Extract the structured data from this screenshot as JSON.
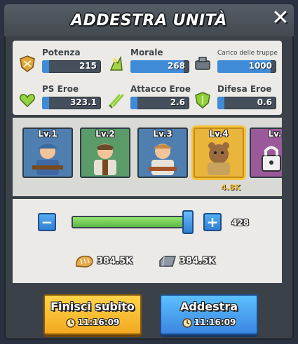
{
  "window": {
    "title": "ADDESTRA UNITÀ"
  },
  "stats": [
    {
      "label": "Potenza",
      "value": "215",
      "icon": "power-shield-icon",
      "fill": 0.12
    },
    {
      "label": "Morale",
      "value": "268",
      "icon": "morale-icon",
      "fill": 0.9
    },
    {
      "label": "Carico delle truppe",
      "value": "1000",
      "icon": "troop-load-icon",
      "fill": 0.9
    },
    {
      "label": "PS Eroe",
      "value": "323.1",
      "icon": "hero-hp-icon",
      "fill": 0.12
    },
    {
      "label": "Attacco Eroe",
      "value": "2.6",
      "icon": "hero-attack-icon",
      "fill": 0.12
    },
    {
      "label": "Difesa Eroe",
      "value": "0.6",
      "icon": "hero-defense-icon",
      "fill": 0.12
    }
  ],
  "units": [
    {
      "level": "Lv.1",
      "bg": "#4f7fb0"
    },
    {
      "level": "Lv.2",
      "bg": "#5b9b6a"
    },
    {
      "level": "Lv.3",
      "bg": "#4f7fb0"
    },
    {
      "level": "Lv.4",
      "bg": "#e9b53a",
      "selected": true
    },
    {
      "level": "Lv.",
      "bg": "#9a5a9a",
      "locked": true
    }
  ],
  "unit_cost": "4.8K",
  "quantity": {
    "minus": "−",
    "plus": "+",
    "value": "428",
    "fraction": 1.0
  },
  "resources": [
    {
      "amount": "384.5K",
      "icon": "bread-icon"
    },
    {
      "amount": "384.5K",
      "icon": "iron-ingot-icon"
    }
  ],
  "buttons": {
    "finish_now": {
      "label": "Finisci subito",
      "time": "11:16:09"
    },
    "train": {
      "label": "Addestra",
      "time": "11:16:09"
    }
  },
  "colors": {
    "accent_blue": "#3f8bd8",
    "slider_green": "#5bb64a",
    "gold": "#f6c338"
  }
}
